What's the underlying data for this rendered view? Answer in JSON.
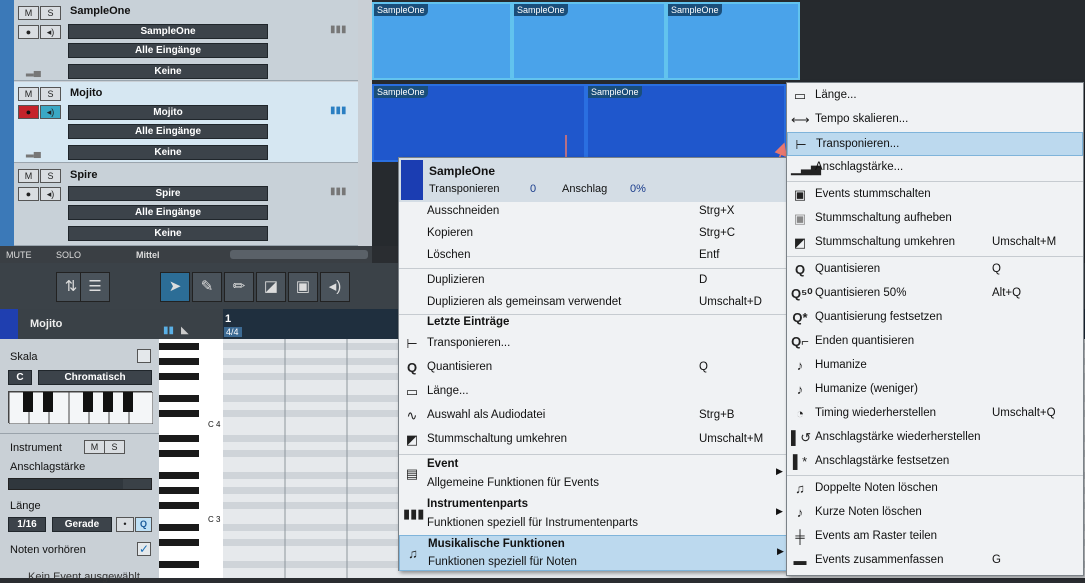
{
  "tracks": [
    {
      "name": "SampleOne",
      "instrument": "SampleOne",
      "input": "Alle Eingänge",
      "output": "Keine",
      "mute": "M",
      "solo": "S"
    },
    {
      "name": "Mojito",
      "instrument": "Mojito",
      "input": "Alle Eingänge",
      "output": "Keine",
      "mute": "M",
      "solo": "S"
    },
    {
      "name": "Spire",
      "instrument": "Spire",
      "input": "Alle Eingänge",
      "output": "Keine",
      "mute": "M",
      "solo": "S"
    }
  ],
  "clips": [
    "SampleOne",
    "SampleOne",
    "SampleOne",
    "SampleOne",
    "SampleOne"
  ],
  "bottombar": {
    "mute": "MUTE",
    "solo": "SOLO",
    "zoom": "Mittel"
  },
  "inspector": {
    "track": "Mojito",
    "scale_label": "Skala",
    "root": "C",
    "scale": "Chromatisch",
    "instrument_label": "Instrument",
    "m": "M",
    "s": "S",
    "velocity_label": "Anschlagstärke",
    "length_label": "Länge",
    "quant": "1/16",
    "mode": "Gerade",
    "q": "Q",
    "preview_label": "Noten vorhören",
    "no_event": "Kein Event ausgewählt"
  },
  "piano": {
    "c4": "C 4",
    "c3": "C 3"
  },
  "ruler": {
    "bar": "1",
    "sig": "4/4"
  },
  "ctx": {
    "header_title": "SampleOne",
    "transpose_label": "Transponieren",
    "transpose_val": "0",
    "velocity_label": "Anschlag",
    "velocity_val": "0%",
    "items": [
      {
        "t": "Ausschneiden",
        "k": "Strg+X"
      },
      {
        "t": "Kopieren",
        "k": "Strg+C"
      },
      {
        "t": "Löschen",
        "k": "Entf"
      },
      {
        "t": "Duplizieren",
        "k": "D"
      },
      {
        "t": "Duplizieren als gemeinsam verwendet",
        "k": "Umschalt+D"
      }
    ],
    "recent_header": "Letzte Einträge",
    "recent": [
      {
        "t": "Transponieren...",
        "k": ""
      },
      {
        "t": "Quantisieren",
        "k": "Q"
      },
      {
        "t": "Länge...",
        "k": ""
      },
      {
        "t": "Auswahl als Audiodatei",
        "k": "Strg+B"
      },
      {
        "t": "Stummschaltung umkehren",
        "k": "Umschalt+M"
      }
    ],
    "groups": [
      {
        "t": "Event",
        "sub": "Allgemeine Funktionen für Events"
      },
      {
        "t": "Instrumentenparts",
        "sub": "Funktionen speziell für Instrumentenparts"
      },
      {
        "t": "Musikalische Funktionen",
        "sub": "Funktionen speziell für Noten"
      }
    ]
  },
  "submenu": [
    {
      "t": "Länge...",
      "k": ""
    },
    {
      "t": "Tempo skalieren...",
      "k": ""
    },
    {
      "t": "Transponieren...",
      "k": ""
    },
    {
      "t": "Anschlagstärke...",
      "k": ""
    },
    {
      "t": "Events stummschalten",
      "k": ""
    },
    {
      "t": "Stummschaltung aufheben",
      "k": ""
    },
    {
      "t": "Stummschaltung umkehren",
      "k": "Umschalt+M"
    },
    {
      "t": "Quantisieren",
      "k": "Q"
    },
    {
      "t": "Quantisieren 50%",
      "k": "Alt+Q"
    },
    {
      "t": "Quantisierung festsetzen",
      "k": ""
    },
    {
      "t": "Enden quantisieren",
      "k": ""
    },
    {
      "t": "Humanize",
      "k": ""
    },
    {
      "t": "Humanize (weniger)",
      "k": ""
    },
    {
      "t": "Timing wiederherstellen",
      "k": "Umschalt+Q"
    },
    {
      "t": "Anschlagstärke wiederherstellen",
      "k": ""
    },
    {
      "t": "Anschlagstärke festsetzen",
      "k": ""
    },
    {
      "t": "Doppelte Noten löschen",
      "k": ""
    },
    {
      "t": "Kurze Noten löschen",
      "k": ""
    },
    {
      "t": "Events am Raster teilen",
      "k": ""
    },
    {
      "t": "Events zusammenfassen",
      "k": "G"
    }
  ],
  "colors": {
    "clip_light": "#4aa3ea",
    "clip_dark": "#1f57cc",
    "highlight": "#bcd9ee",
    "arrow": "#e8786e"
  }
}
